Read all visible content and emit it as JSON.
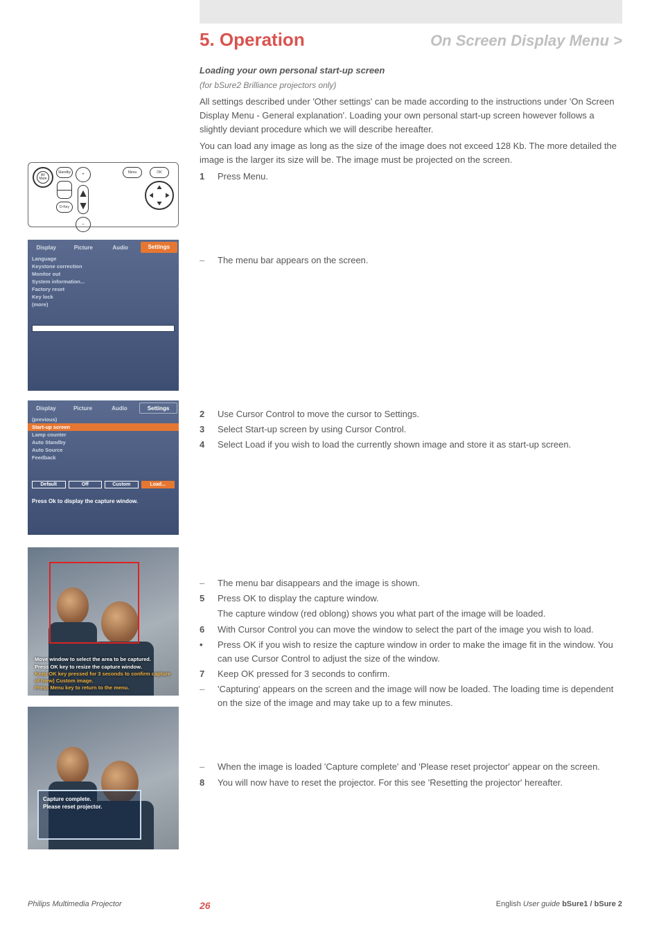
{
  "header": {
    "left": "5. Operation",
    "right": "On Screen Display Menu >"
  },
  "section": {
    "title": "Loading your own personal start-up screen",
    "subtitle": "(for bSure2 Brilliance projectors only)",
    "intro1": "All settings described under 'Other settings' can be made according to the instructions under 'On Screen Display Menu - General explanation'. Loading your own personal start-up screen however follows a slightly deviant procedure which we will describe hereafter.",
    "intro2": "You can load any image as long as the size of the image does not exceed 128 Kb. The more detailed the image is the larger its size will be. The image must be projected on the screen."
  },
  "steps": {
    "s1_num": "1",
    "s1": "Press Menu.",
    "d1": "The menu bar appears on the screen.",
    "s2_num": "2",
    "s2": "Use Cursor Control to move the cursor to Settings.",
    "s3_num": "3",
    "s3": "Select Start-up screen by using Cursor Control.",
    "s4_num": "4",
    "s4": "Select Load if you wish to load the currently shown image and store it as start-up screen.",
    "d2": "The menu bar disappears and the image is shown.",
    "s5_num": "5",
    "s5": "Press OK to display the capture window.",
    "s5b": "The capture window (red oblong) shows you what part of the image will be loaded.",
    "s6_num": "6",
    "s6": "With Cursor Control you can move the window to select the part of the image you wish to load.",
    "bullet": "•",
    "bullet_txt": "Press OK if you wish to resize the capture window in order to make the image fit in the window. You can use Cursor Control to adjust the size of the window.",
    "s7_num": "7",
    "s7": "Keep OK pressed for 3 seconds to confirm.",
    "d3": "'Capturing' appears on the screen and the image will now be loaded. The loading time is dependent on the size of the image and may take up to a few minutes.",
    "d4": "When the image is loaded 'Capture complete' and 'Please reset projector' appear on the screen.",
    "s8_num": "8",
    "s8": "You will now have to reset the projector. For this see 'Resetting the projector' hereafter."
  },
  "osd1": {
    "tabs": [
      "Display",
      "Picture",
      "Audio",
      "Settings"
    ],
    "items": [
      "Language",
      "Keystone correction",
      "Monitor out",
      "System information...",
      "Factory reset",
      "Key lock",
      "(more)"
    ]
  },
  "osd2": {
    "tabs": [
      "Display",
      "Picture",
      "Audio",
      "Settings"
    ],
    "items": [
      "(previous)",
      "Start-up screen",
      "Lamp counter",
      "Auto Standby",
      "Auto Source",
      "Feedback"
    ],
    "buttons": [
      "Default",
      "Off",
      "Custom",
      "Load..."
    ],
    "hint": "Press Ok to display the capture window."
  },
  "capture1": {
    "l1": "Move window to select the area to be captured.",
    "l2": "Press OK key to resize the capture window.",
    "l3": "Keep OK key pressed for 3 seconds to confirm capture of (new) Custom image.",
    "l4": "Press Menu key to return to the menu."
  },
  "capture2": {
    "l1": "Capture complete.",
    "l2": "Please reset projector."
  },
  "remote": {
    "av_mute": "AV\nMute",
    "standby": "Standby",
    "dkey": "D-Key",
    "plus": "+",
    "minus": "–",
    "menu": "Menu",
    "ok": "OK"
  },
  "footer": {
    "left": "Philips Multimedia Projector",
    "page": "26",
    "right_plain": "English ",
    "right_italic": "User guide  ",
    "right_bold": "bSure1 / bSure 2"
  }
}
